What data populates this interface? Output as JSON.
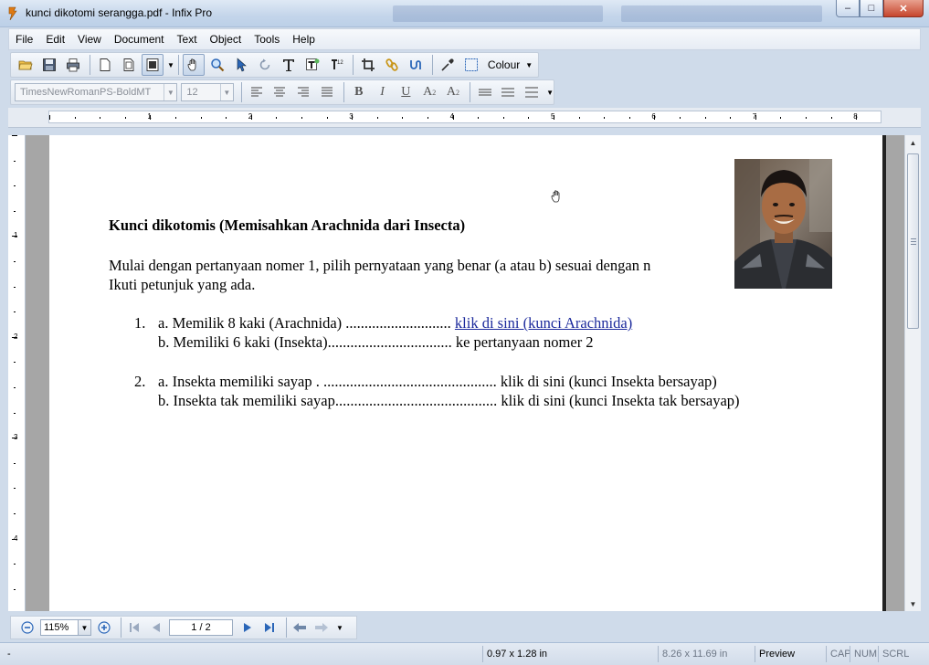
{
  "window": {
    "title": "kunci dikotomi serangga.pdf - Infix Pro",
    "minimize": "–",
    "maximize": "□",
    "close": "✕"
  },
  "menu": [
    "File",
    "Edit",
    "View",
    "Document",
    "Text",
    "Object",
    "Tools",
    "Help"
  ],
  "toolbar": {
    "colour_label": "Colour",
    "font_name": "TimesNewRomanPS-BoldMT",
    "font_size": "12"
  },
  "ruler": {
    "horizontal_numbers": [
      "1",
      "2",
      "3",
      "4",
      "5",
      "6",
      "7",
      "8"
    ],
    "vertical_numbers": [
      "1",
      "2",
      "3",
      "4"
    ]
  },
  "document": {
    "heading": "Kunci dikotomis (Memisahkan Arachnida dari Insecta)",
    "intro_line1": "Mulai dengan pertanyaan nomer 1, pilih pernyataan yang benar (a atau b) sesuai dengan n",
    "intro_line2": "Ikuti petunjuk yang ada.",
    "q1_number": "1.",
    "q1_a_text": "a. Memilik 8 kaki (Arachnida) ............................",
    "q1_a_link": "klik di sini (kunci Arachnida)",
    "q1_b_text": "b. Memiliki 6 kaki (Insekta)................................. ke pertanyaan nomer 2",
    "q2_number": "2.",
    "q2_a_text": "a. Insekta memiliki sayap . .............................................. klik di sini (kunci Insekta bersayap)",
    "q2_b_text": "b. Insekta tak memiliki sayap........................................... klik di sini (kunci Insekta tak bersayap)"
  },
  "navigation": {
    "zoom": "115%",
    "page": "1 / 2"
  },
  "status": {
    "left": "-",
    "selection_size": "0.97 x 1.28 in",
    "page_size": "8.26 x 11.69 in",
    "mode": "Preview",
    "cap": "CAP",
    "num": "NUM",
    "scrl": "SCRL"
  },
  "colors": {
    "link": "#1c2a9c",
    "accent": "#2a66b8",
    "window_chrome": "#cfdbea"
  }
}
